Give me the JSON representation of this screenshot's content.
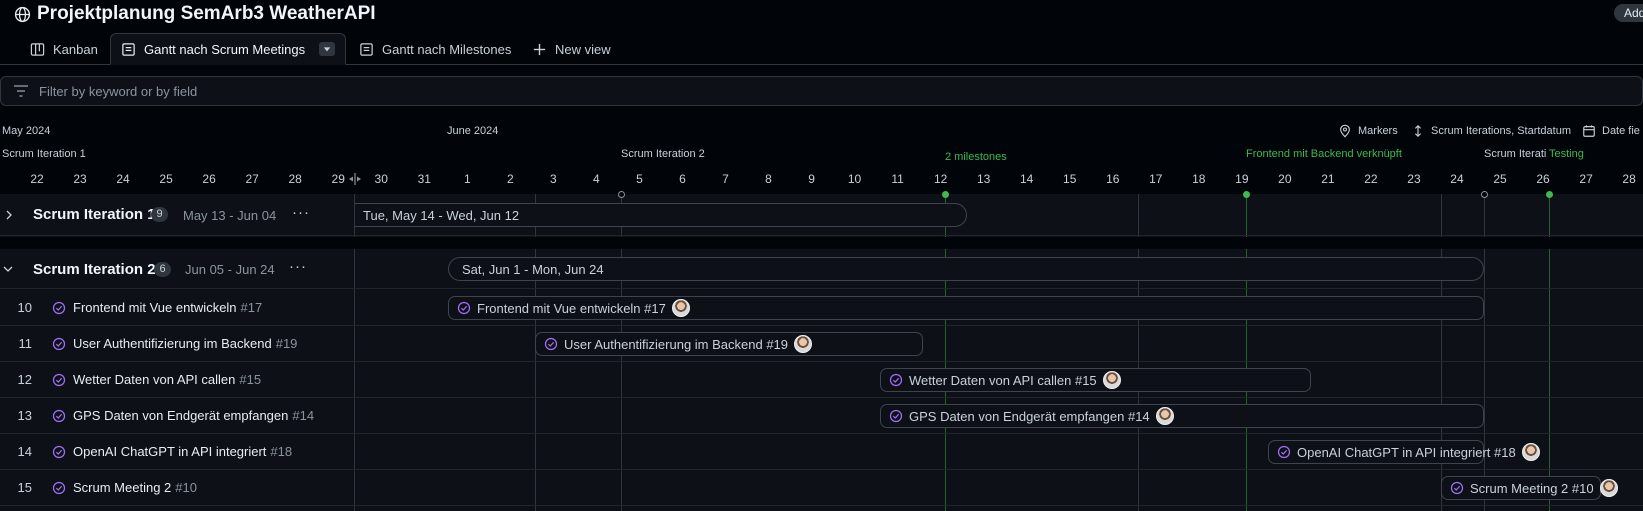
{
  "project": {
    "title": "Projektplanung SemArb3 WeatherAPI",
    "add_label": "Add"
  },
  "tabs": [
    {
      "label": "Kanban",
      "icon": "board-icon"
    },
    {
      "label": "Gantt nach Scrum Meetings",
      "icon": "table-icon",
      "active": true
    },
    {
      "label": "Gantt nach Milestones",
      "icon": "table-icon"
    },
    {
      "label": "New view",
      "icon": "plus-icon"
    }
  ],
  "filter": {
    "placeholder": "Filter by keyword or by field"
  },
  "timeline": {
    "months": {
      "may": "May 2024",
      "june": "June 2024"
    },
    "iterations": {
      "it1": "Scrum Iteration 1",
      "it2": "Scrum Iteration 2",
      "it3": "Scrum Iterati"
    },
    "milestones": {
      "m1": "2 milestones",
      "m2": "Frontend mit Backend verknüpft",
      "m3": "Testing"
    },
    "controls": {
      "markers": "Markers",
      "iterations": "Scrum Iterations, Startdatum",
      "date": "Date fie"
    },
    "days": [
      "22",
      "23",
      "24",
      "25",
      "26",
      "27",
      "28",
      "29",
      "30",
      "31",
      "1",
      "2",
      "3",
      "4",
      "5",
      "6",
      "7",
      "8",
      "9",
      "10",
      "11",
      "12",
      "13",
      "14",
      "15",
      "16",
      "17",
      "18",
      "19",
      "20",
      "21",
      "22",
      "23",
      "24",
      "25",
      "26",
      "27",
      "28"
    ]
  },
  "groups": [
    {
      "title": "Scrum Iteration 1",
      "count": "9",
      "range": "May 13 - Jun 04",
      "bar": "Tue, May 14 - Wed, Jun 12"
    },
    {
      "title": "Scrum Iteration 2",
      "count": "6",
      "range": "Jun 05 - Jun 24",
      "bar": "Sat, Jun 1 - Mon, Jun 24"
    }
  ],
  "items": [
    {
      "num": "10",
      "title": "Frontend mit Vue entwickeln",
      "ref": "#17",
      "bar": "Frontend mit Vue entwickeln #17"
    },
    {
      "num": "11",
      "title": "User Authentifizierung im Backend",
      "ref": "#19",
      "bar": "User Authentifizierung im Backend #19"
    },
    {
      "num": "12",
      "title": "Wetter Daten von API callen",
      "ref": "#15",
      "bar": "Wetter Daten von API callen #15"
    },
    {
      "num": "13",
      "title": "GPS Daten von Endgerät empfangen",
      "ref": "#14",
      "bar": "GPS Daten von Endgerät empfangen #14"
    },
    {
      "num": "14",
      "title": "OpenAI ChatGPT in API integriert",
      "ref": "#18",
      "bar": "OpenAI ChatGPT in API integriert #18"
    },
    {
      "num": "15",
      "title": "Scrum Meeting 2",
      "ref": "#10",
      "bar": "Scrum Meeting 2 #10"
    }
  ],
  "colors": {
    "accent": "#3fb950",
    "icon_purple": "#a371f7",
    "border": "#30363d"
  }
}
